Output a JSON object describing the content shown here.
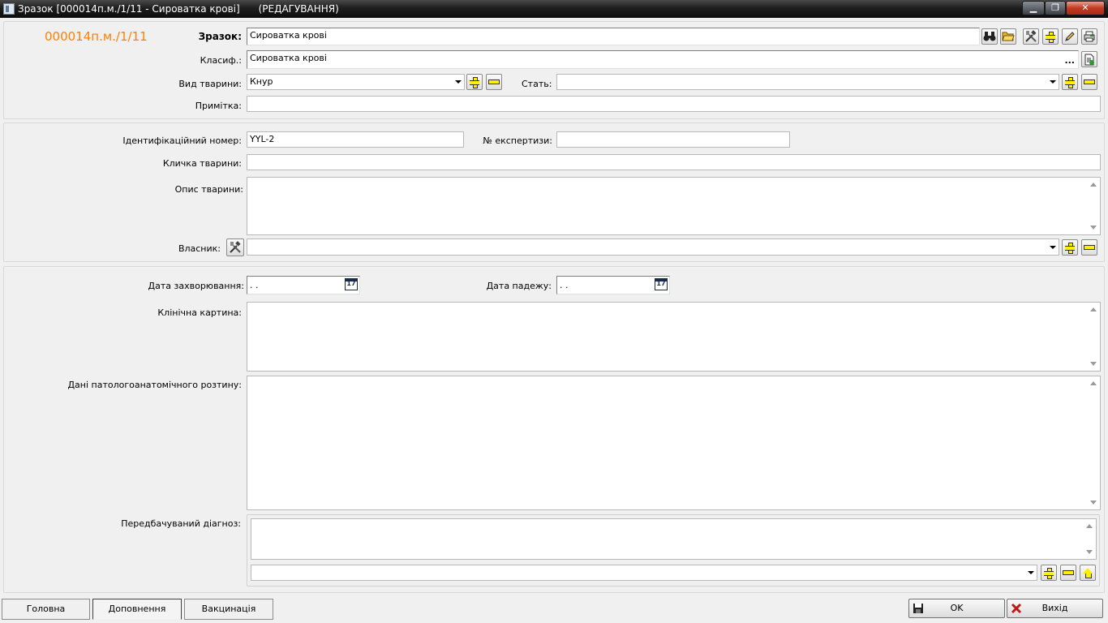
{
  "window": {
    "title": "Зразок [000014п.м./1/11 - Сироватка крові]      (РЕДАГУВАННЯ)",
    "min_label": "▁",
    "max_label": "❐",
    "close_label": "✕"
  },
  "header": {
    "sample_code": "000014п.м./1/11",
    "accent_color": "#ff8000"
  },
  "sample": {
    "label": "Зразок:",
    "value": "Сироватка крові"
  },
  "classif": {
    "label": "Класиф.:",
    "value": "Сироватка крові",
    "ellipsis": "..."
  },
  "animal_type": {
    "label": "Вид тварини:",
    "value": "Кнур"
  },
  "sex": {
    "label": "Стать:",
    "value": ""
  },
  "note": {
    "label": "Примітка:",
    "value": ""
  },
  "ident": {
    "label": "Ідентифікаційний номер:",
    "value": "YYL-2"
  },
  "expertise": {
    "label": "№ експертизи:",
    "value": ""
  },
  "nickname": {
    "label": "Кличка тварини:",
    "value": ""
  },
  "description": {
    "label": "Опис тварини:",
    "value": ""
  },
  "owner": {
    "label": "Власник:",
    "value": ""
  },
  "disease_date": {
    "label": "Дата захворювання:",
    "value": " .  ."
  },
  "death_date": {
    "label": "Дата падежу:",
    "value": " .  ."
  },
  "clinical": {
    "label": "Клінічна картина:",
    "value": ""
  },
  "autopsy": {
    "label": "Дані патологоанатомічного розтину:",
    "value": ""
  },
  "diagnosis": {
    "label": "Передбачуваний діагноз:",
    "value": "",
    "select_value": ""
  },
  "tabs": [
    {
      "label": "Головна"
    },
    {
      "label": "Доповнення"
    },
    {
      "label": "Вакцинація"
    }
  ],
  "actions": {
    "ok_label": "OK",
    "exit_label": "Вихід"
  }
}
